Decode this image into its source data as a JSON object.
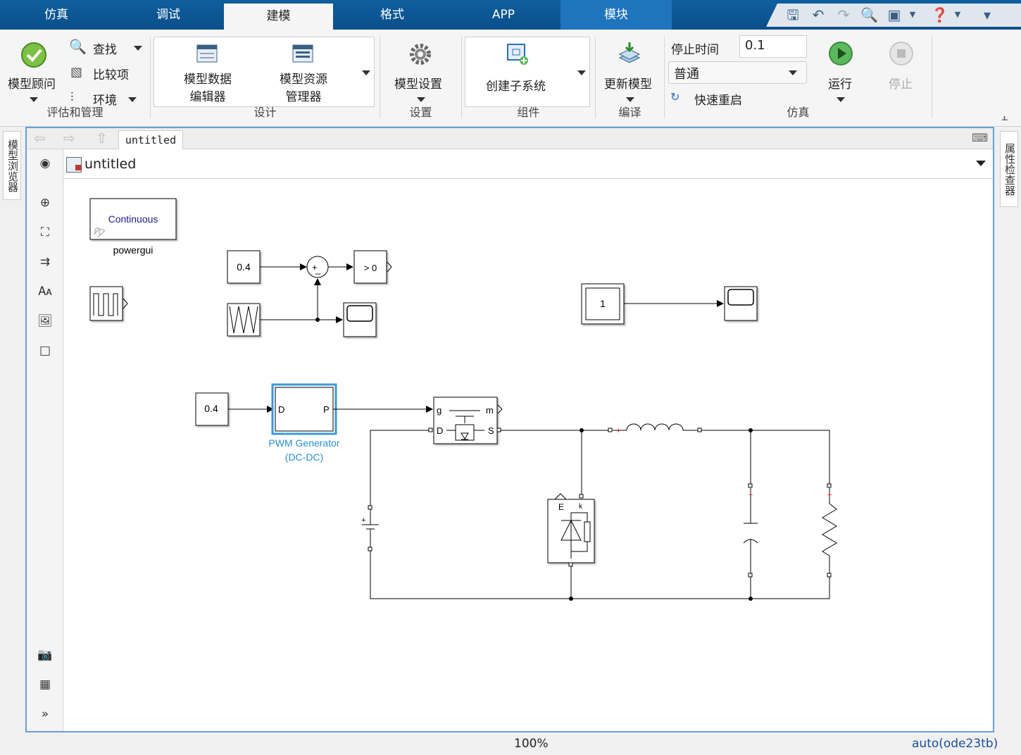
{
  "tabs": [
    {
      "label": "仿真"
    },
    {
      "label": "调试"
    },
    {
      "label": "建模"
    },
    {
      "label": "格式"
    },
    {
      "label": "APP"
    },
    {
      "label": "模块"
    }
  ],
  "ribbon": {
    "eval": {
      "advisor": "模型顾问",
      "find": "查找",
      "compare": "比较项",
      "env": "环境",
      "label": "评估和管理"
    },
    "design": {
      "data_editor_1": "模型数据",
      "data_editor_2": "编辑器",
      "resource_1": "模型资源",
      "resource_2": "管理器",
      "label": "设计"
    },
    "settings": {
      "model_settings": "模型设置",
      "label": "设置"
    },
    "component": {
      "create_subsystem": "创建子系统",
      "label": "组件"
    },
    "compile": {
      "update": "更新模型",
      "label": "编译"
    },
    "sim": {
      "stop_time_label": "停止时间",
      "stop_time": "0.1",
      "mode": "普通",
      "fast_restart": "快速重启",
      "run": "运行",
      "stop": "停止",
      "label": "仿真"
    }
  },
  "left_panel": {
    "model_browser": "模型浏览器"
  },
  "right_panel": {
    "property_inspector": "属性检查器"
  },
  "editor": {
    "tab": "untitled",
    "address": "untitled"
  },
  "diagram": {
    "powergui_text": "Continuous",
    "powergui_label": "powergui",
    "const1": "0.4",
    "sum_plus": "+",
    "sum_minus": "_",
    "compare": "> 0",
    "const2": "1",
    "const3": "0.4",
    "pwm_d": "D",
    "pwm_p": "P",
    "pwm_label1": "PWM Generator",
    "pwm_label2": "(DC-DC)",
    "mos_g": "g",
    "mos_m": "m",
    "mos_d": "D",
    "mos_s": "S",
    "diode_e": "E",
    "diode_k": "k",
    "batt_plus": "+"
  },
  "status": {
    "zoom": "100%",
    "solver": "auto(ode23tb)"
  },
  "colors": {
    "tabbar": "#0b5394",
    "accent": "#1f74bd",
    "selected_block": "#3a9ad9"
  }
}
